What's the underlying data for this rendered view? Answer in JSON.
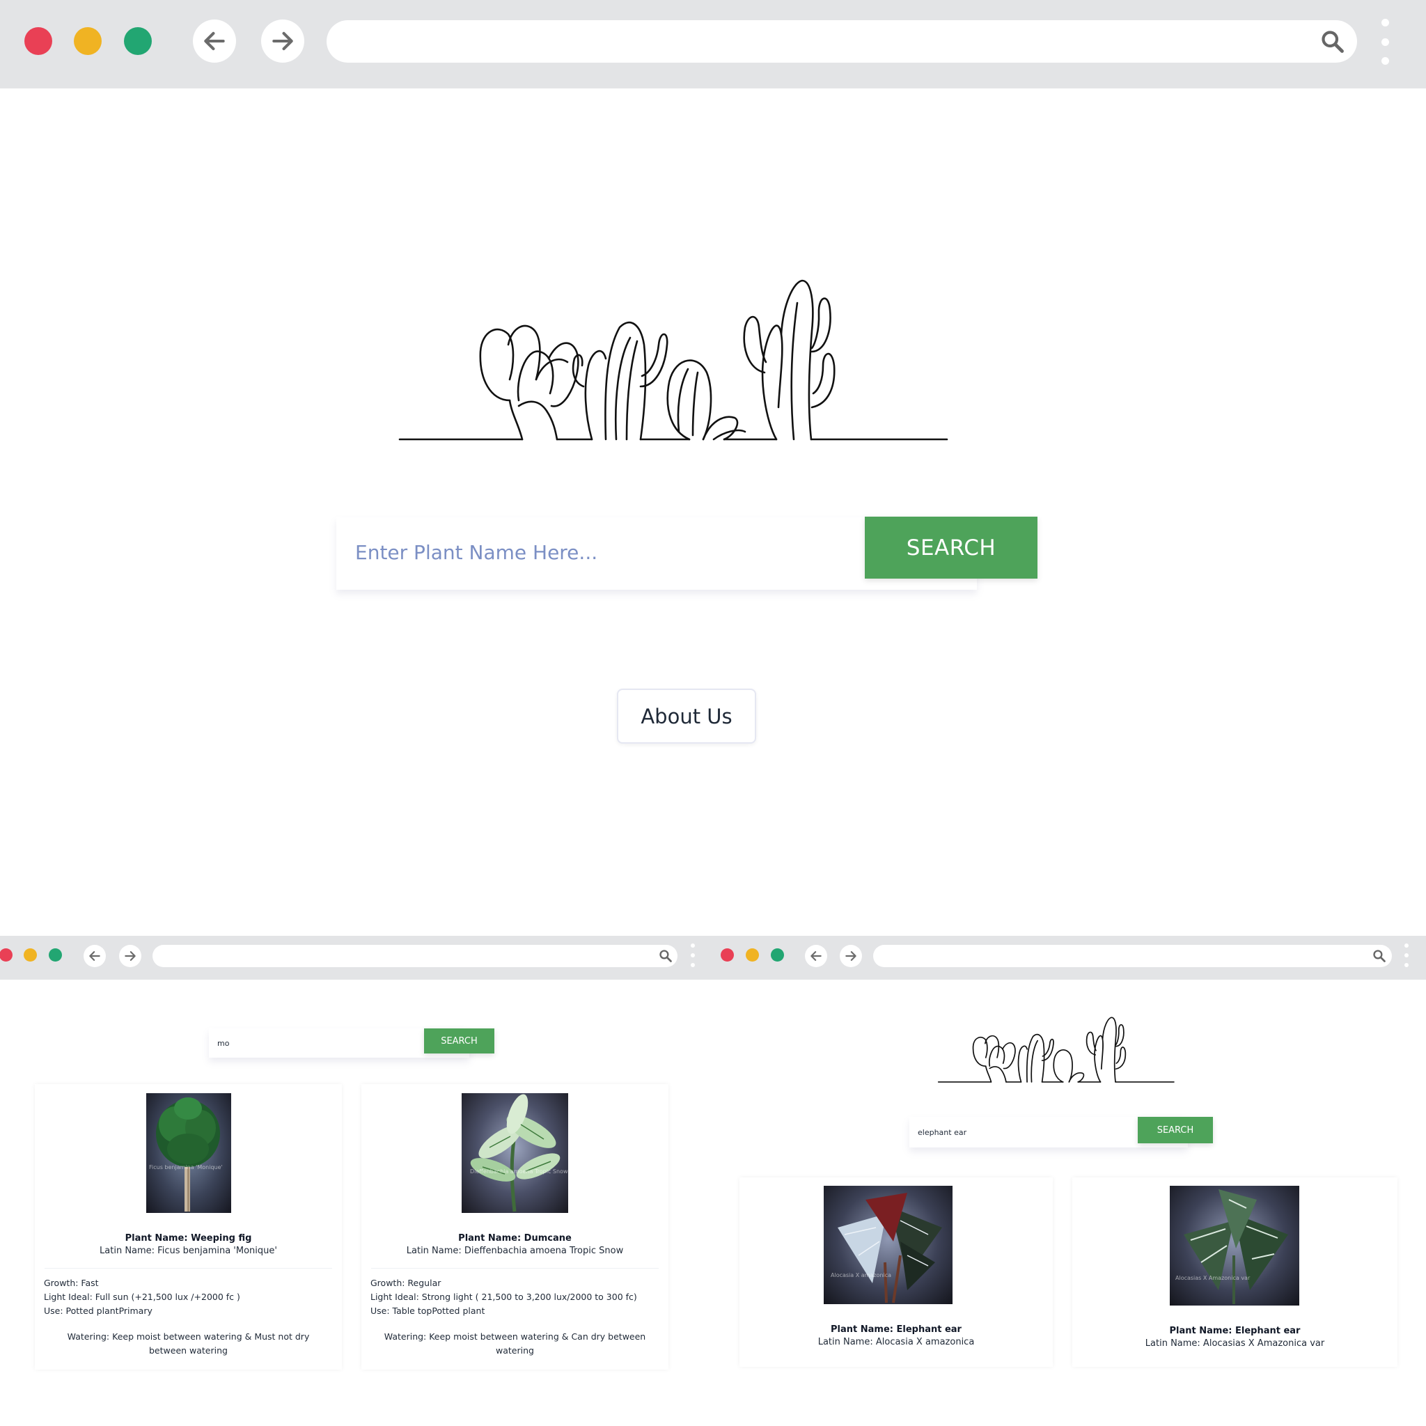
{
  "main_window": {
    "search": {
      "placeholder": "Enter Plant Name Here...",
      "button_label": "SEARCH"
    },
    "about_button_label": "About Us"
  },
  "results_window_left": {
    "search": {
      "value": "mo",
      "button_label": "SEARCH"
    },
    "cards": [
      {
        "plant_name": "Plant Name: Weeping fig",
        "latin_name": "Latin Name: Ficus benjamina 'Monique'",
        "image_caption": "Ficus benjamina 'Monique'",
        "growth": "Growth: Fast",
        "light": "Light Ideal: Full sun (+21,500 lux /+2000 fc )",
        "use": "Use: Potted plantPrimary",
        "watering": "Watering: Keep moist between watering & Must not dry between watering"
      },
      {
        "plant_name": "Plant Name: Dumcane",
        "latin_name": "Latin Name: Dieffenbachia amoena Tropic Snow",
        "image_caption": "Dieffenbachia amoena Tropic Snow",
        "growth": "Growth: Regular",
        "light": "Light Ideal: Strong light ( 21,500 to 3,200 lux/2000 to 300 fc)",
        "use": "Use: Table topPotted plant",
        "watering": "Watering: Keep moist between watering & Can dry between watering"
      }
    ]
  },
  "results_window_right": {
    "search": {
      "value": "elephant ear",
      "button_label": "SEARCH"
    },
    "cards": [
      {
        "plant_name": "Plant Name: Elephant ear",
        "latin_name": "Latin Name: Alocasia X amazonica",
        "image_caption": "Alocasia X amazonica"
      },
      {
        "plant_name": "Plant Name: Elephant ear",
        "latin_name": "Latin Name: Alocasias X Amazonica var",
        "image_caption": "Alocasias X Amazonica var"
      }
    ]
  },
  "colors": {
    "chrome_bg": "#e3e4e6",
    "traffic_red": "#e94055",
    "traffic_yellow": "#f0b323",
    "traffic_green": "#22a672",
    "search_button": "#4ea35a",
    "placeholder": "#7b8fc4"
  },
  "icons": [
    "back-arrow-icon",
    "forward-arrow-icon",
    "search-icon",
    "kebab-menu-icon",
    "cactus-line-art-logo"
  ]
}
